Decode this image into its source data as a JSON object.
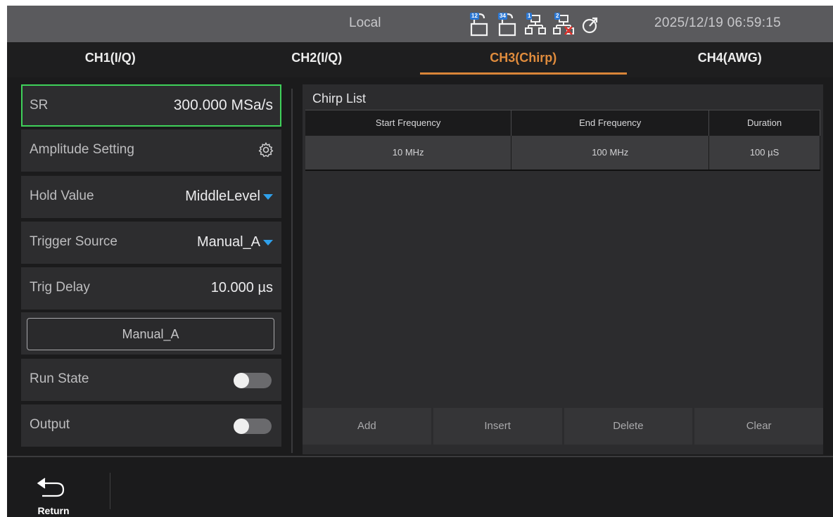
{
  "status_bar": {
    "mode": "Local",
    "datetime": "2025/12/19 06:59:15",
    "icons": [
      {
        "name": "trigger-12-icon",
        "badge": "12"
      },
      {
        "name": "trigger-34-icon",
        "badge": "34"
      },
      {
        "name": "network-1-icon",
        "badge": "1"
      },
      {
        "name": "network-2-disconnected-icon",
        "badge": "2"
      },
      {
        "name": "power-icon",
        "badge": ""
      }
    ]
  },
  "tabs": [
    {
      "label": "CH1(I/Q)",
      "active": false
    },
    {
      "label": "CH2(I/Q)",
      "active": false
    },
    {
      "label": "CH3(Chirp)",
      "active": true
    },
    {
      "label": "CH4(AWG)",
      "active": false
    }
  ],
  "left_panel": {
    "sr": {
      "label": "SR",
      "value": "300.000 MSa/s"
    },
    "amplitude": {
      "label": "Amplitude Setting"
    },
    "hold_value": {
      "label": "Hold Value",
      "value": "MiddleLevel"
    },
    "trigger_source": {
      "label": "Trigger Source",
      "value": "Manual_A"
    },
    "trig_delay": {
      "label": "Trig Delay",
      "value": "10.000 µs"
    },
    "manual_button": "Manual_A",
    "run_state": {
      "label": "Run State",
      "on": false
    },
    "output": {
      "label": "Output",
      "on": false
    }
  },
  "chirp": {
    "title": "Chirp List",
    "columns": [
      "Start Frequency",
      "End Frequency",
      "Duration"
    ],
    "rows": [
      [
        "10 MHz",
        "100 MHz",
        "100 µS"
      ]
    ],
    "actions": [
      "Add",
      "Insert",
      "Delete",
      "Clear"
    ]
  },
  "bottom": {
    "return_label": "Return"
  },
  "colors": {
    "accent_tab": "#e08c3d",
    "selected_border": "#3fd15a",
    "dropdown_caret": "#2fa0ea"
  }
}
